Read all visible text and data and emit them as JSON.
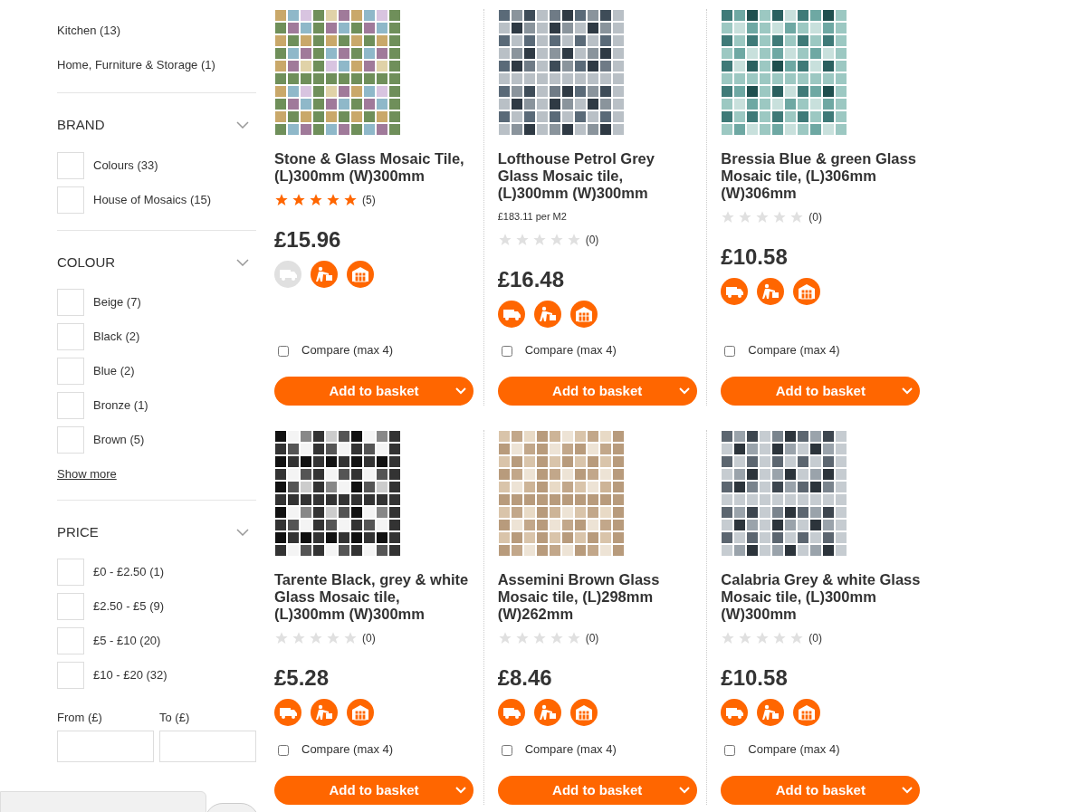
{
  "sidebar": {
    "categories": [
      {
        "label": "Kitchen (13)"
      },
      {
        "label": "Home, Furniture & Storage (1)"
      }
    ],
    "filters": [
      {
        "title": "BRAND",
        "expanded": true,
        "options": [
          {
            "label": "Colours (33)",
            "checked": false
          },
          {
            "label": "House of Mosaics (15)",
            "checked": false
          }
        ]
      },
      {
        "title": "COLOUR",
        "expanded": true,
        "options": [
          {
            "label": "Beige (7)",
            "checked": false
          },
          {
            "label": "Black (2)",
            "checked": false
          },
          {
            "label": "Blue (2)",
            "checked": false
          },
          {
            "label": "Bronze (1)",
            "checked": false
          },
          {
            "label": "Brown (5)",
            "checked": false
          }
        ],
        "show_more": "Show more"
      },
      {
        "title": "PRICE",
        "expanded": true,
        "options": [
          {
            "label": "£0 - £2.50 (1)",
            "checked": false
          },
          {
            "label": "£2.50 - £5 (9)",
            "checked": false
          },
          {
            "label": "£5 - £10 (20)",
            "checked": false
          },
          {
            "label": "£10 - £20 (32)",
            "checked": false
          }
        ],
        "range": {
          "from_label": "From (£)",
          "to_label": "To (£)"
        }
      }
    ]
  },
  "products": [
    {
      "title": "Stone & Glass Mosaic Tile, (L)300mm (W)300mm",
      "stars": 5,
      "reviews": "(5)",
      "price": "£15.96",
      "services": [
        {
          "kind": "delivery",
          "available": false
        },
        {
          "kind": "collect",
          "available": true
        },
        {
          "kind": "store",
          "available": true
        }
      ],
      "compare": {
        "label": "Compare (max 4)",
        "checked": false
      },
      "button": "Add to basket"
    },
    {
      "title": "Lofthouse Petrol Grey Glass Mosaic tile, (L)300mm (W)300mm",
      "unit_price": "£183.11 per M2",
      "stars": 0,
      "reviews": "(0)",
      "price": "£16.48",
      "services": [
        {
          "kind": "delivery",
          "available": true
        },
        {
          "kind": "collect",
          "available": true
        },
        {
          "kind": "store",
          "available": true
        }
      ],
      "compare": {
        "label": "Compare (max 4)",
        "checked": false
      },
      "button": "Add to basket"
    },
    {
      "title": "Bressia Blue & green Glass Mosaic tile, (L)306mm (W)306mm",
      "stars": 0,
      "reviews": "(0)",
      "price": "£10.58",
      "services": [
        {
          "kind": "delivery",
          "available": true
        },
        {
          "kind": "collect",
          "available": true
        },
        {
          "kind": "store",
          "available": true
        }
      ],
      "compare": {
        "label": "Compare (max 4)",
        "checked": false
      },
      "button": "Add to basket"
    },
    {
      "title": "Tarente Black, grey & white Glass Mosaic tile, (L)300mm (W)300mm",
      "stars": 0,
      "reviews": "(0)",
      "price": "£5.28",
      "services": [
        {
          "kind": "delivery",
          "available": true
        },
        {
          "kind": "collect",
          "available": true
        },
        {
          "kind": "store",
          "available": true
        }
      ],
      "compare": {
        "label": "Compare (max 4)",
        "checked": false
      },
      "button": "Add to basket"
    },
    {
      "title": "Assemini Brown Glass Mosaic tile, (L)298mm (W)262mm",
      "stars": 0,
      "reviews": "(0)",
      "price": "£8.46",
      "services": [
        {
          "kind": "delivery",
          "available": true
        },
        {
          "kind": "collect",
          "available": true
        },
        {
          "kind": "store",
          "available": true
        }
      ],
      "compare": {
        "label": "Compare (max 4)",
        "checked": false
      },
      "button": "Add to basket"
    },
    {
      "title": "Calabria Grey & white Glass Mosaic tile, (L)300mm (W)300mm",
      "stars": 0,
      "reviews": "(0)",
      "price": "£10.58",
      "services": [
        {
          "kind": "delivery",
          "available": true
        },
        {
          "kind": "collect",
          "available": true
        },
        {
          "kind": "store",
          "available": true
        }
      ],
      "compare": {
        "label": "Compare (max 4)",
        "checked": false
      },
      "button": "Add to basket"
    }
  ]
}
